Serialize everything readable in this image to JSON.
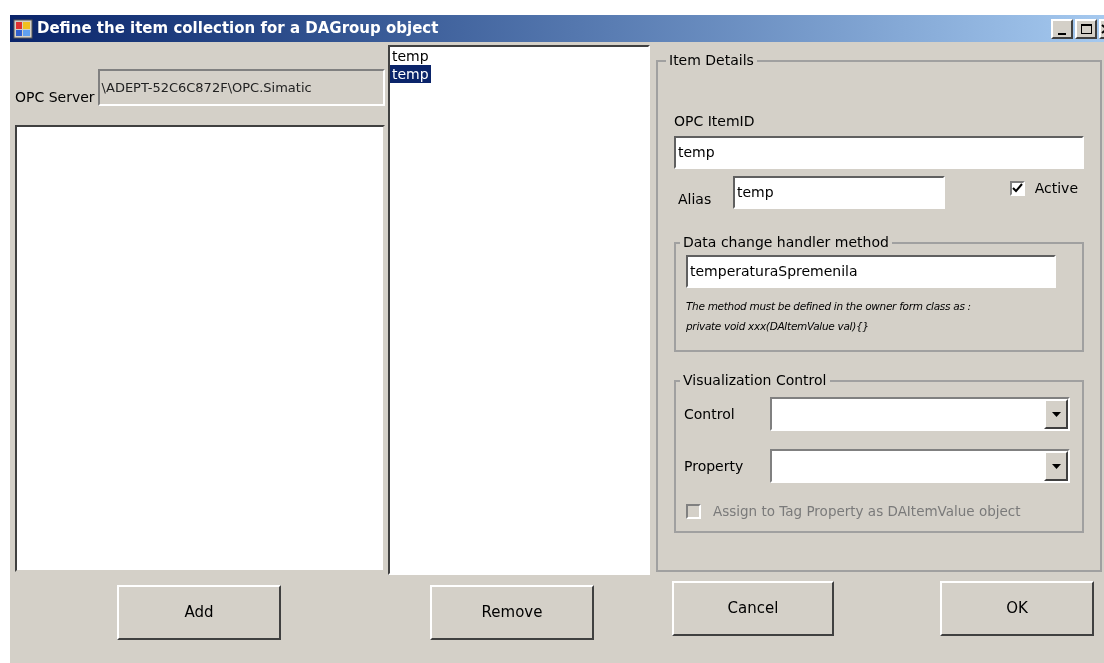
{
  "window": {
    "title": "Define the item collection for a DAGroup object"
  },
  "opc_server": {
    "label": "OPC Server",
    "value": "\\ADEPT-52C6C872F\\OPC.Simatic"
  },
  "items": [
    {
      "label": "temp",
      "selected": false
    },
    {
      "label": "temp",
      "selected": true
    }
  ],
  "item_details": {
    "title": "Item Details",
    "item_id": {
      "label": "OPC ItemID",
      "value": "temp"
    },
    "alias": {
      "label": "Alias",
      "value": "temp"
    },
    "active": {
      "label": "Active",
      "checked": true
    },
    "handler": {
      "title": "Data change handler method",
      "value": "temperaturaSpremenila",
      "note": "The method must be defined in the owner form class as : private void xxx(DAItemValue val){}"
    },
    "visualization": {
      "title": "Visualization Control",
      "control": {
        "label": "Control"
      },
      "property": {
        "label": "Property"
      },
      "assign": {
        "label": "Assign to Tag Property as DAItemValue object",
        "checked": false,
        "disabled": true
      }
    }
  },
  "buttons": [
    "Add",
    "Remove",
    "Cancel",
    "OK"
  ]
}
